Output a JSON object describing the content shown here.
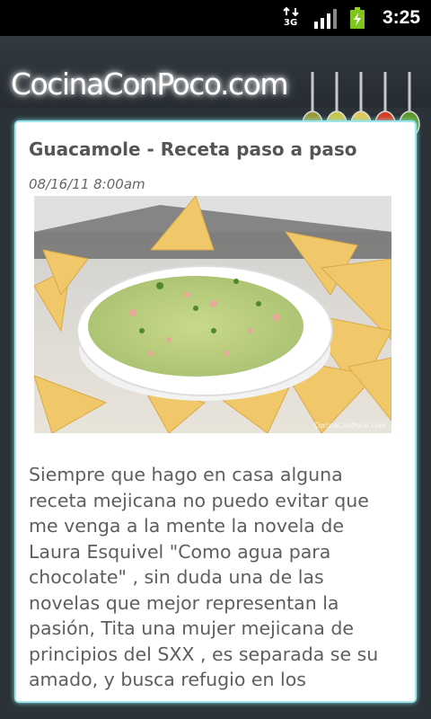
{
  "status_bar": {
    "network": "3G",
    "time": "3:25",
    "icons": [
      "network-3g-icon",
      "signal-icon",
      "battery-charging-icon"
    ]
  },
  "header": {
    "brand": "CocinaConPoco.com",
    "decoration": "spice-spoons",
    "spoon_colors": [
      "#9a9a3a",
      "#c9c64a",
      "#e0c95a",
      "#d63a22",
      "#5e9a2a"
    ]
  },
  "post": {
    "title": "Guacamole - Receta paso a paso",
    "date": "08/16/11 8:00am",
    "image": {
      "name": "guacamole-photo",
      "watermark": "CocinaConPoco.com"
    },
    "body": "Siempre que hago en casa alguna receta mejicana no puedo evitar que me venga a la mente la novela de Laura Esquivel \"Como agua para chocolate\" , sin duda una de las novelas que mejor representan la pasión, Tita una mujer mejicana de principios del SXX , es separada se su amado, y busca refugio en los"
  },
  "colors": {
    "accent_border": "#9fe6ec",
    "app_background": "#2b3238",
    "text": "#5e5e5e"
  }
}
